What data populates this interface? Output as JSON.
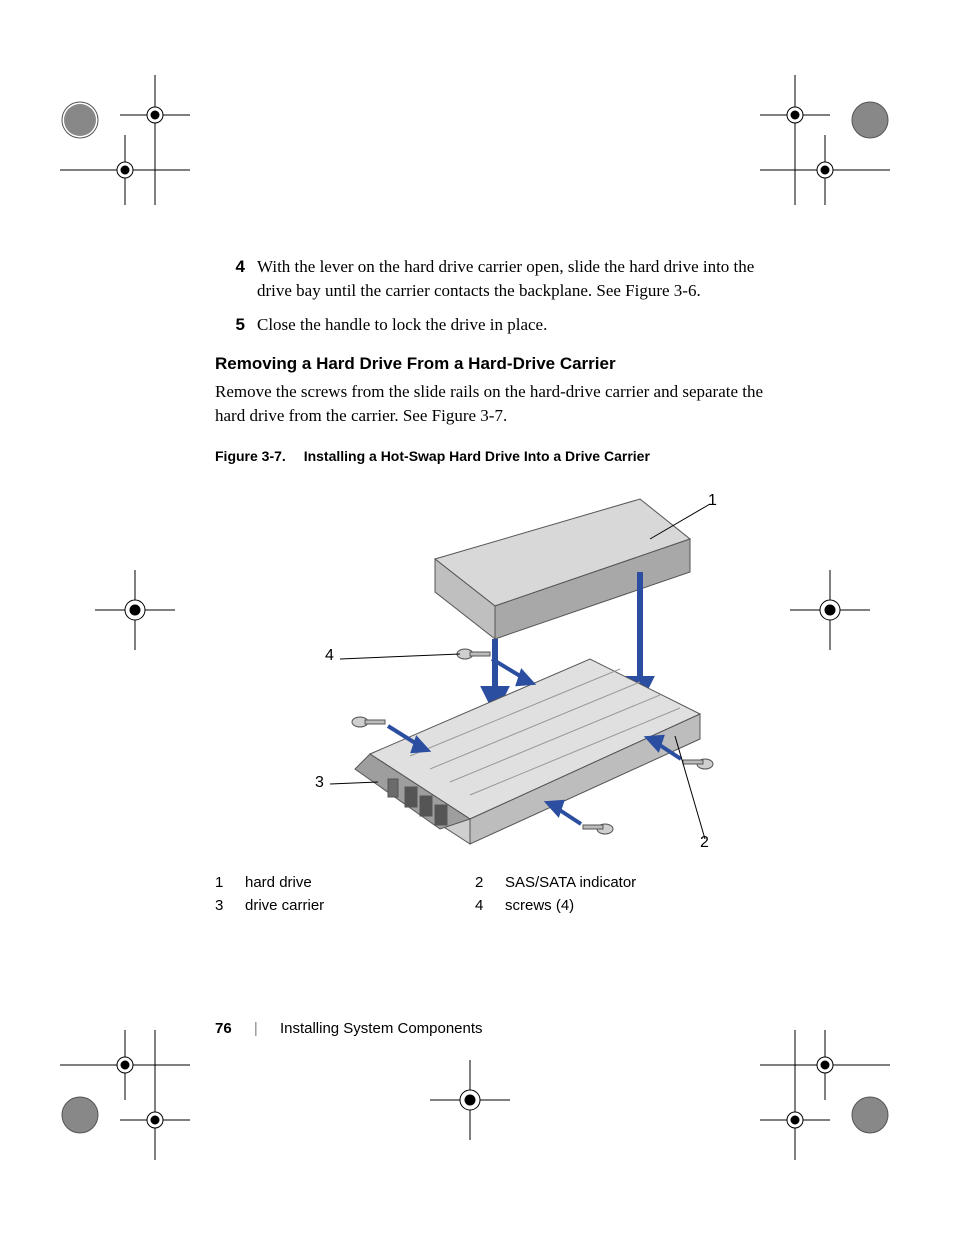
{
  "steps": [
    {
      "num": "4",
      "text": "With the lever on the hard drive carrier open, slide the hard drive into the drive bay until the carrier contacts the backplane. See Figure 3-6."
    },
    {
      "num": "5",
      "text": "Close the handle to lock the drive in place."
    }
  ],
  "section_heading": "Removing a Hard Drive From a Hard-Drive Carrier",
  "body_text": "Remove the screws from the slide rails on the hard-drive carrier and separate the hard drive from the carrier. See Figure 3-7.",
  "figure": {
    "num": "Figure 3-7.",
    "title": "Installing a Hot-Swap Hard Drive Into a Drive Carrier",
    "callouts": {
      "c1": "1",
      "c2": "2",
      "c3": "3",
      "c4": "4"
    },
    "legend": [
      {
        "num": "1",
        "label": "hard drive"
      },
      {
        "num": "2",
        "label": "SAS/SATA indicator"
      },
      {
        "num": "3",
        "label": "drive carrier"
      },
      {
        "num": "4",
        "label": "screws (4)"
      }
    ]
  },
  "footer": {
    "page": "76",
    "section": "Installing System Components"
  }
}
